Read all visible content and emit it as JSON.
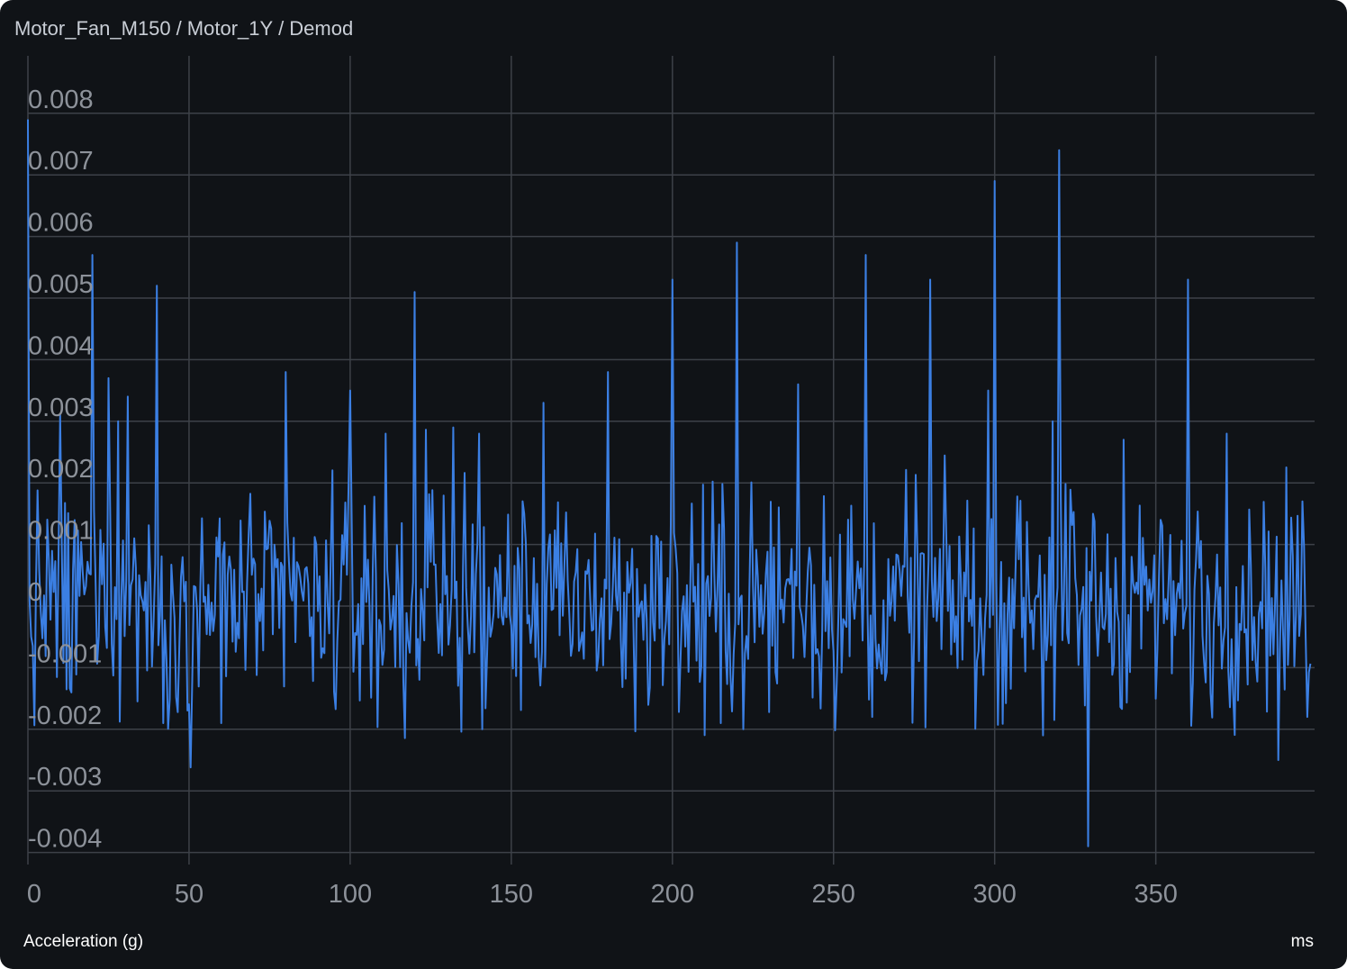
{
  "breadcrumb": [
    "Motor_Fan_M150",
    "Motor_1Y",
    "Demod"
  ],
  "colors": {
    "background": "#101317",
    "grid": "#3d4148",
    "line": "#3b7fe3",
    "tick": "#8d929a",
    "text": "#ffffff"
  },
  "chart_data": {
    "type": "line",
    "xlabel": "ms",
    "ylabel": "Acceleration (g)",
    "xlim": [
      0,
      398
    ],
    "ylim": [
      -0.0045,
      0.0088
    ],
    "xticks": [
      0,
      50,
      100,
      150,
      200,
      250,
      300,
      350
    ],
    "yticks": [
      0.008,
      0.007,
      0.006,
      0.005,
      0.004,
      0.003,
      0.002,
      0.001,
      0,
      -0.001,
      -0.002,
      -0.003,
      -0.004
    ],
    "ytick_labels": [
      "0.008",
      "0.007",
      "0.006",
      "0.005",
      "0.004",
      "0.003",
      "0.002",
      "0.001",
      "0",
      "-0.001",
      "-0.002",
      "-0.003",
      "-0.004"
    ],
    "xtick_labels": [
      "0",
      "50",
      "100",
      "150",
      "200",
      "250",
      "300",
      "350"
    ],
    "grid": true,
    "series": [
      {
        "color": "#3b7fe3",
        "sample_interval_ms": 0.5,
        "peaks": [
          {
            "x": 0,
            "y": 0.0079
          },
          {
            "x": 10,
            "y": 0.0031
          },
          {
            "x": 20,
            "y": 0.0057
          },
          {
            "x": 25,
            "y": 0.0037
          },
          {
            "x": 28,
            "y": 0.003
          },
          {
            "x": 31,
            "y": 0.0034
          },
          {
            "x": 40,
            "y": 0.0052
          },
          {
            "x": 60,
            "y": 0.0053
          },
          {
            "x": 80,
            "y": 0.0038
          },
          {
            "x": 100,
            "y": 0.0035
          },
          {
            "x": 111,
            "y": 0.0028
          },
          {
            "x": 120,
            "y": 0.0051
          },
          {
            "x": 132,
            "y": 0.0029
          },
          {
            "x": 140,
            "y": 0.0028
          },
          {
            "x": 160,
            "y": 0.0033
          },
          {
            "x": 180,
            "y": 0.0038
          },
          {
            "x": 200,
            "y": 0.0053
          },
          {
            "x": 220,
            "y": 0.0059
          },
          {
            "x": 239,
            "y": 0.0036
          },
          {
            "x": 260,
            "y": 0.0057
          },
          {
            "x": 280,
            "y": 0.0053
          },
          {
            "x": 298,
            "y": 0.0035
          },
          {
            "x": 300,
            "y": 0.0069
          },
          {
            "x": 318,
            "y": 0.003
          },
          {
            "x": 320,
            "y": 0.0074
          },
          {
            "x": 340,
            "y": 0.0027
          },
          {
            "x": 360,
            "y": 0.0053
          },
          {
            "x": 372,
            "y": 0.0028
          }
        ],
        "troughs": [
          {
            "x": 42,
            "y": -0.0019
          },
          {
            "x": 60,
            "y": -0.0019
          },
          {
            "x": 141,
            "y": -0.002
          },
          {
            "x": 215,
            "y": -0.0019
          },
          {
            "x": 222,
            "y": -0.002
          },
          {
            "x": 262,
            "y": -0.0018
          },
          {
            "x": 315,
            "y": -0.0021
          },
          {
            "x": 329,
            "y": -0.0039
          },
          {
            "x": 388,
            "y": -0.0025
          },
          {
            "x": 397,
            "y": -0.0018
          }
        ],
        "baseline_range": [
          -0.0015,
          0.0019
        ]
      }
    ]
  }
}
